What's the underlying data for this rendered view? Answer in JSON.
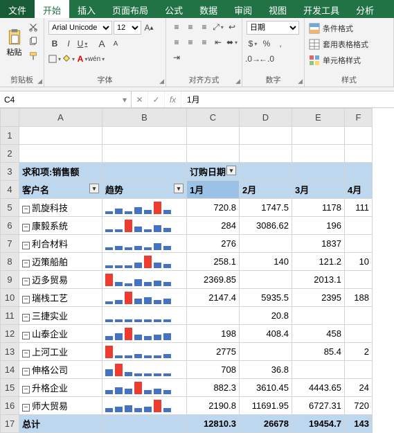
{
  "tabs": {
    "file": "文件",
    "home": "开始",
    "insert": "插入",
    "layout": "页面布局",
    "formula": "公式",
    "data": "数据",
    "review": "审阅",
    "view": "视图",
    "dev": "开发工具",
    "analysis": "分析"
  },
  "ribbon": {
    "clipboard": {
      "paste": "粘贴",
      "label": "剪贴板"
    },
    "font": {
      "name": "Arial Unicode",
      "size": "12",
      "label": "字体",
      "pinyin": "wén"
    },
    "align": {
      "label": "对齐方式"
    },
    "number": {
      "format": "日期",
      "label": "数字"
    },
    "styles": {
      "cond": "条件格式",
      "table": "套用表格格式",
      "cell": "单元格样式",
      "label": "样式"
    }
  },
  "namebox": "C4",
  "fxvalue": "1月",
  "cols": [
    "A",
    "B",
    "C",
    "D",
    "E",
    "F"
  ],
  "pivot": {
    "measure": "求和项:销售额",
    "orderdate": "订购日期",
    "customer": "客户名",
    "trend": "趋势"
  },
  "months": [
    "1月",
    "2月",
    "3月",
    "4月"
  ],
  "rows": [
    {
      "name": "凯旋科技",
      "spark": [
        2,
        4,
        2,
        5,
        3,
        9,
        3
      ],
      "max": 5,
      "vals": [
        "720.8",
        "1747.5",
        "1178",
        "111"
      ]
    },
    {
      "name": "康毅系统",
      "spark": [
        2,
        2,
        9,
        4,
        2,
        5,
        3
      ],
      "max": 2,
      "vals": [
        "284",
        "3086.62",
        "196",
        ""
      ]
    },
    {
      "name": "利合材料",
      "spark": [
        2,
        3,
        2,
        3,
        2,
        5,
        3
      ],
      "max": -1,
      "vals": [
        "276",
        "",
        "1837",
        ""
      ]
    },
    {
      "name": "迈策船舶",
      "spark": [
        2,
        2,
        2,
        4,
        9,
        4,
        3
      ],
      "max": 4,
      "vals": [
        "258.1",
        "140",
        "121.2",
        "10"
      ]
    },
    {
      "name": "迈多贸易",
      "spark": [
        9,
        3,
        2,
        5,
        3,
        4,
        3
      ],
      "max": 0,
      "vals": [
        "2369.85",
        "",
        "2013.1",
        ""
      ]
    },
    {
      "name": "瑞栈工艺",
      "spark": [
        2,
        3,
        9,
        4,
        5,
        3,
        4
      ],
      "max": 2,
      "vals": [
        "2147.4",
        "5935.5",
        "2395",
        "188"
      ]
    },
    {
      "name": "三捷实业",
      "spark": [
        2,
        2,
        2,
        2,
        2,
        2,
        2
      ],
      "max": -1,
      "vals": [
        "",
        "20.8",
        "",
        ""
      ]
    },
    {
      "name": "山泰企业",
      "spark": [
        3,
        5,
        9,
        4,
        3,
        4,
        5
      ],
      "max": 2,
      "vals": [
        "198",
        "408.4",
        "458",
        ""
      ]
    },
    {
      "name": "上河工业",
      "spark": [
        9,
        2,
        2,
        3,
        2,
        2,
        3
      ],
      "max": 0,
      "vals": [
        "2775",
        "",
        "85.4",
        "2"
      ]
    },
    {
      "name": "伸格公司",
      "spark": [
        5,
        9,
        3,
        2,
        2,
        2,
        2
      ],
      "max": 1,
      "vals": [
        "708",
        "36.8",
        "",
        ""
      ]
    },
    {
      "name": "升格企业",
      "spark": [
        3,
        5,
        4,
        9,
        3,
        4,
        3
      ],
      "max": 3,
      "vals": [
        "882.3",
        "3610.45",
        "4443.65",
        "24"
      ]
    },
    {
      "name": "师大贸易",
      "spark": [
        3,
        4,
        5,
        3,
        4,
        9,
        3
      ],
      "max": 5,
      "vals": [
        "2190.8",
        "11691.95",
        "6727.31",
        "720"
      ]
    }
  ],
  "total": {
    "label": "总计",
    "vals": [
      "12810.3",
      "26678",
      "19454.7",
      "143"
    ]
  }
}
